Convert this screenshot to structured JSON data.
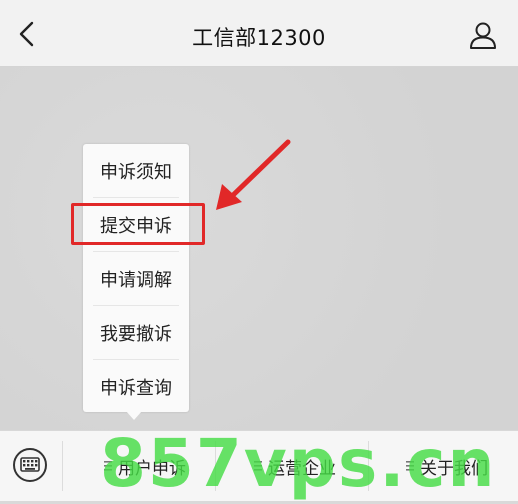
{
  "header": {
    "title": "工信部12300"
  },
  "menu": {
    "items": [
      {
        "label": "申诉须知"
      },
      {
        "label": "提交申诉"
      },
      {
        "label": "申请调解"
      },
      {
        "label": "我要撤诉"
      },
      {
        "label": "申诉查询"
      }
    ]
  },
  "bottom_tabs": [
    {
      "label": "用户申诉"
    },
    {
      "label": "运营企业"
    },
    {
      "label": "关于我们"
    }
  ],
  "watermark": {
    "text": "857vps.cn"
  },
  "colors": {
    "highlight": "#e12828",
    "watermark": "#46dc46"
  },
  "icons": {
    "back": "chevron-left-icon",
    "profile": "user-icon",
    "keyboard": "keyboard-icon",
    "menu": "hamburger-icon"
  }
}
